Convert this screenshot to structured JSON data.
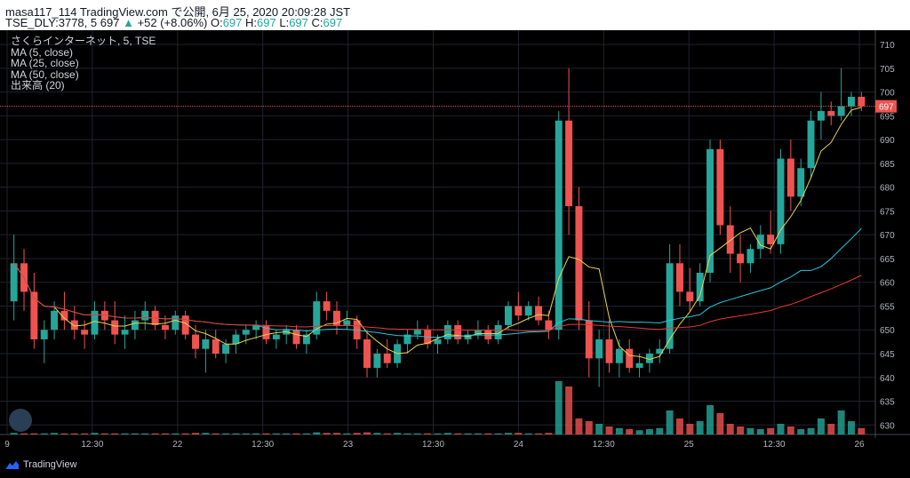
{
  "header": {
    "line1": "masa117_114 TradingView.com で公開, 6月 25, 2020 20:09:28 JST",
    "line2_symbol": "TSE_DLY:3778, 5",
    "line2_price": "697",
    "line2_change_arrow": "▲",
    "line2_change": "+52 (+8.06%)",
    "o_label": "O:",
    "o_value": "697",
    "h_label": "H:",
    "h_value": "697",
    "l_label": "L:",
    "l_value": "697",
    "c_label": "C:",
    "c_value": "697"
  },
  "legend": {
    "title": "さくらインターネット, 5, TSE",
    "ma5": "MA (5, close)",
    "ma25": "MA (25, close)",
    "ma50": "MA (50, close)",
    "volume": "出来高 (20)"
  },
  "footer": {
    "brand": "TradingView"
  },
  "colors": {
    "background": "#000000",
    "grid": "#1f2330",
    "up": "#26a69a",
    "down": "#ef5350",
    "ma5": "#e8d44d",
    "ma25": "#26c6da",
    "ma50": "#e53935",
    "price_line": "#ef5350",
    "text": "#b2b5be"
  },
  "chart_data": {
    "type": "candlestick",
    "yaxis": {
      "ticks": [
        630,
        635,
        640,
        645,
        650,
        655,
        660,
        665,
        670,
        675,
        680,
        685,
        690,
        695,
        700,
        705,
        710
      ],
      "ylim": [
        628,
        713
      ]
    },
    "xaxis": {
      "tick_labels": [
        "9",
        "12:30",
        "22",
        "12:30",
        "23",
        "12:30",
        "24",
        "12:30",
        "25",
        "12:30",
        "26"
      ]
    },
    "last_price": 697,
    "price_label": "697",
    "candles": [
      [
        656,
        670,
        652,
        664
      ],
      [
        664,
        667,
        654,
        658
      ],
      [
        658,
        662,
        646,
        648
      ],
      [
        648,
        652,
        643,
        650
      ],
      [
        650,
        656,
        648,
        654
      ],
      [
        654,
        658,
        650,
        652
      ],
      [
        652,
        655,
        648,
        650
      ],
      [
        650,
        652,
        646,
        649
      ],
      [
        649,
        656,
        648,
        654
      ],
      [
        654,
        656,
        650,
        652
      ],
      [
        652,
        656,
        647,
        649
      ],
      [
        649,
        653,
        646,
        650
      ],
      [
        650,
        654,
        648,
        652
      ],
      [
        652,
        656,
        650,
        654
      ],
      [
        654,
        655,
        650,
        651
      ],
      [
        651,
        653,
        648,
        650
      ],
      [
        650,
        654,
        649,
        653
      ],
      [
        653,
        654,
        648,
        649
      ],
      [
        649,
        651,
        644,
        646
      ],
      [
        646,
        650,
        641,
        648
      ],
      [
        648,
        650,
        644,
        645
      ],
      [
        645,
        648,
        643,
        647
      ],
      [
        647,
        650,
        645,
        649
      ],
      [
        649,
        651,
        647,
        650
      ],
      [
        650,
        652,
        648,
        651
      ],
      [
        651,
        652,
        647,
        648
      ],
      [
        648,
        650,
        646,
        649
      ],
      [
        649,
        651,
        647,
        650
      ],
      [
        650,
        651,
        646,
        647
      ],
      [
        647,
        650,
        645,
        649
      ],
      [
        649,
        658,
        648,
        656
      ],
      [
        656,
        658,
        652,
        654
      ],
      [
        654,
        656,
        649,
        651
      ],
      [
        651,
        654,
        650,
        652
      ],
      [
        652,
        653,
        646,
        648
      ],
      [
        648,
        650,
        640,
        642
      ],
      [
        642,
        646,
        640,
        645
      ],
      [
        645,
        648,
        642,
        643
      ],
      [
        643,
        648,
        642,
        647
      ],
      [
        647,
        650,
        645,
        649
      ],
      [
        649,
        652,
        648,
        650
      ],
      [
        650,
        651,
        646,
        647
      ],
      [
        647,
        649,
        645,
        648
      ],
      [
        648,
        652,
        647,
        651
      ],
      [
        651,
        652,
        647,
        648
      ],
      [
        648,
        650,
        647,
        649
      ],
      [
        649,
        652,
        648,
        650
      ],
      [
        650,
        651,
        647,
        648
      ],
      [
        648,
        652,
        647,
        651
      ],
      [
        651,
        656,
        650,
        655
      ],
      [
        655,
        658,
        652,
        653
      ],
      [
        653,
        656,
        652,
        655
      ],
      [
        655,
        657,
        651,
        652
      ],
      [
        652,
        654,
        648,
        650
      ],
      [
        650,
        696,
        648,
        694
      ],
      [
        694,
        705,
        670,
        676
      ],
      [
        676,
        680,
        650,
        652
      ],
      [
        652,
        656,
        640,
        644
      ],
      [
        644,
        650,
        638,
        648
      ],
      [
        648,
        652,
        641,
        643
      ],
      [
        643,
        648,
        640,
        646
      ],
      [
        646,
        648,
        641,
        642
      ],
      [
        642,
        645,
        640,
        643
      ],
      [
        643,
        646,
        641,
        645
      ],
      [
        645,
        648,
        643,
        646
      ],
      [
        646,
        668,
        645,
        664
      ],
      [
        664,
        668,
        655,
        658
      ],
      [
        658,
        663,
        654,
        656
      ],
      [
        656,
        664,
        655,
        662
      ],
      [
        662,
        690,
        660,
        688
      ],
      [
        688,
        690,
        670,
        672
      ],
      [
        672,
        676,
        662,
        666
      ],
      [
        666,
        670,
        660,
        664
      ],
      [
        664,
        668,
        662,
        667
      ],
      [
        667,
        672,
        665,
        670
      ],
      [
        670,
        675,
        666,
        668
      ],
      [
        668,
        688,
        666,
        686
      ],
      [
        686,
        690,
        675,
        678
      ],
      [
        678,
        686,
        676,
        684
      ],
      [
        684,
        696,
        682,
        694
      ],
      [
        694,
        700,
        690,
        696
      ],
      [
        696,
        698,
        693,
        695
      ],
      [
        695,
        705,
        694,
        697
      ],
      [
        697,
        700,
        695,
        699
      ],
      [
        699,
        700,
        696,
        697
      ]
    ],
    "volume_ylim": [
      0,
      1
    ],
    "volumes": [
      0.03,
      0.02,
      0.02,
      0.02,
      0.03,
      0.02,
      0.02,
      0.02,
      0.03,
      0.02,
      0.02,
      0.02,
      0.02,
      0.02,
      0.02,
      0.02,
      0.02,
      0.02,
      0.03,
      0.03,
      0.02,
      0.02,
      0.02,
      0.02,
      0.02,
      0.02,
      0.02,
      0.02,
      0.02,
      0.02,
      0.04,
      0.03,
      0.03,
      0.02,
      0.03,
      0.04,
      0.03,
      0.02,
      0.03,
      0.02,
      0.02,
      0.02,
      0.02,
      0.03,
      0.02,
      0.02,
      0.02,
      0.02,
      0.02,
      0.03,
      0.03,
      0.02,
      0.02,
      0.03,
      1.0,
      0.9,
      0.3,
      0.25,
      0.2,
      0.15,
      0.12,
      0.1,
      0.08,
      0.1,
      0.12,
      0.45,
      0.3,
      0.2,
      0.25,
      0.55,
      0.4,
      0.2,
      0.15,
      0.12,
      0.1,
      0.12,
      0.2,
      0.15,
      0.1,
      0.12,
      0.3,
      0.2,
      0.45,
      0.25,
      0.12
    ]
  }
}
